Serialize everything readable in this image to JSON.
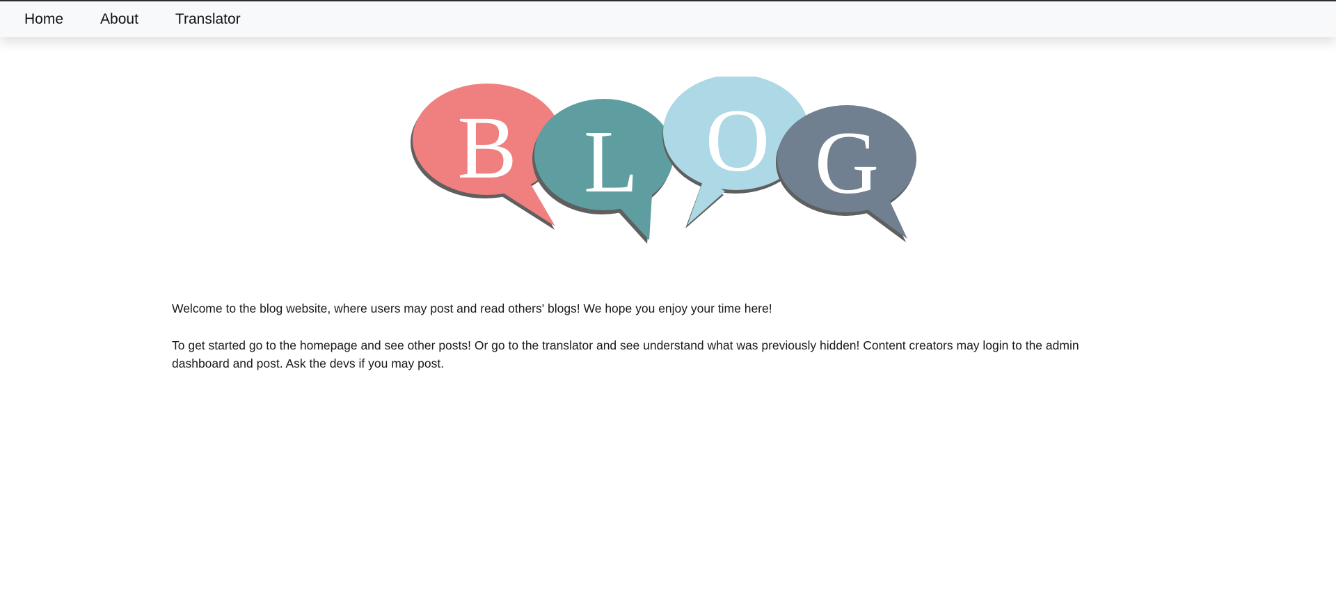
{
  "nav": {
    "items": [
      {
        "label": "Home"
      },
      {
        "label": "About"
      },
      {
        "label": "Translator"
      }
    ]
  },
  "logo": {
    "letters": [
      "B",
      "L",
      "O",
      "G"
    ],
    "colors": [
      "#f08080",
      "#5f9ea0",
      "#add8e6",
      "#708090"
    ],
    "shadow_color": "#5f5f5f"
  },
  "main": {
    "paragraphs": [
      "Welcome to the blog website, where users may post and read others' blogs! We hope you enjoy your time here!",
      "To get started go to the homepage and see other posts! Or go to the translator and see understand what was previously hidden! Content creators may login to the admin dashboard and post. Ask the devs if you may post."
    ]
  }
}
